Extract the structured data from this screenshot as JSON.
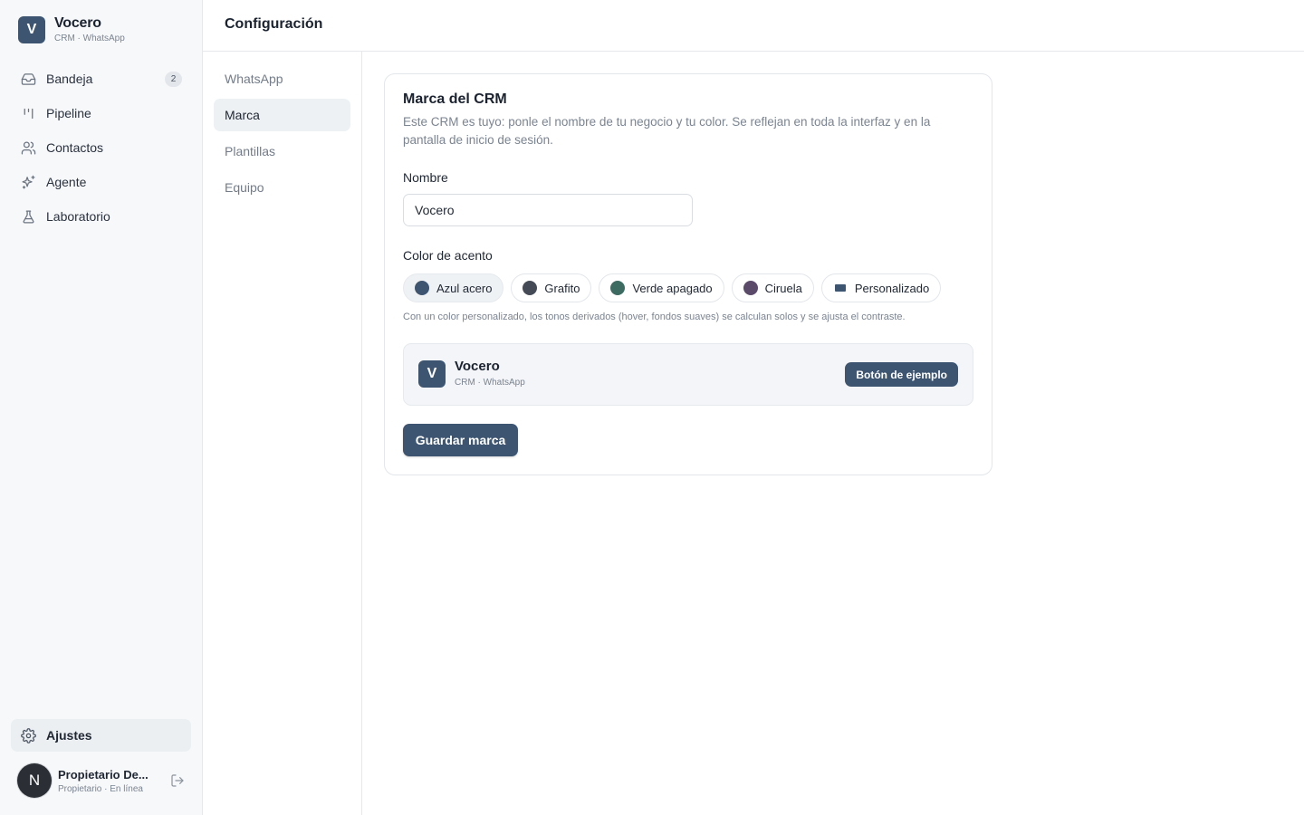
{
  "app": {
    "logo_letter": "V",
    "name": "Vocero",
    "subtitle": "CRM · WhatsApp"
  },
  "nav": {
    "items": [
      {
        "label": "Bandeja",
        "icon": "inbox-icon",
        "badge": "2"
      },
      {
        "label": "Pipeline",
        "icon": "pipeline-icon"
      },
      {
        "label": "Contactos",
        "icon": "contacts-icon"
      },
      {
        "label": "Agente",
        "icon": "sparkles-icon"
      },
      {
        "label": "Laboratorio",
        "icon": "flask-icon"
      }
    ],
    "settings": {
      "label": "Ajustes",
      "icon": "gear-icon"
    }
  },
  "user": {
    "initial": "N",
    "name": "Propietario De...",
    "role": "Propietario · En línea"
  },
  "header": {
    "title": "Configuración"
  },
  "subnav": {
    "items": [
      "WhatsApp",
      "Marca",
      "Plantillas",
      "Equipo"
    ],
    "active": "Marca"
  },
  "card": {
    "title": "Marca del CRM",
    "description": "Este CRM es tuyo: ponle el nombre de tu negocio y tu color. Se reflejan en toda la interfaz y en la pantalla de inicio de sesión.",
    "name_label": "Nombre",
    "name_value": "Vocero",
    "color_label": "Color de acento",
    "swatches": [
      {
        "label": "Azul acero",
        "color": "#3d5570",
        "selected": true
      },
      {
        "label": "Grafito",
        "color": "#454b56",
        "selected": false
      },
      {
        "label": "Verde apagado",
        "color": "#3d6b62",
        "selected": false
      },
      {
        "label": "Ciruela",
        "color": "#5b4a6a",
        "selected": false
      },
      {
        "label": "Personalizado",
        "color": "#3d5570",
        "selected": false
      }
    ],
    "hint": "Con un color personalizado, los tonos derivados (hover, fondos suaves) se calculan solos y se ajusta el contraste.",
    "preview": {
      "logo_letter": "V",
      "name": "Vocero",
      "subtitle": "CRM · WhatsApp",
      "sample_button": "Botón de ejemplo"
    },
    "save_label": "Guardar marca"
  },
  "colors": {
    "accent": "#3d5570"
  }
}
